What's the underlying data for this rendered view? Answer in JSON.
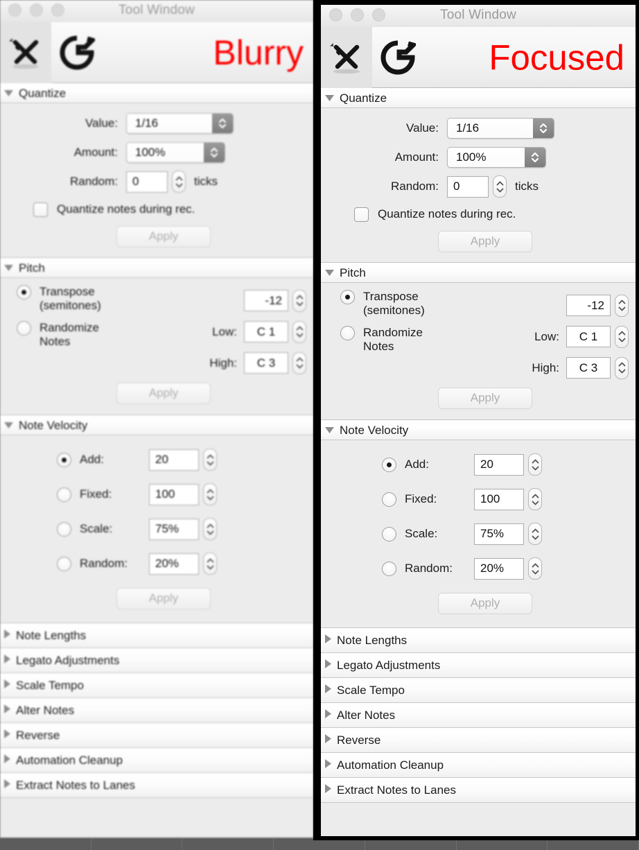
{
  "window": {
    "title": "Tool Window",
    "traffic_lights": [
      "close",
      "minimize",
      "zoom"
    ],
    "tabs": [
      {
        "name": "tools-tab",
        "icon": "wrench-screwdriver-icon",
        "selected": true
      },
      {
        "name": "groove-tab",
        "icon": "groove-g-icon",
        "selected": false
      }
    ]
  },
  "variants": {
    "left": {
      "badge": "Blurry",
      "badge_color": "#ff0000"
    },
    "right": {
      "badge": "Focused",
      "badge_color": "#ff0000"
    }
  },
  "sections": {
    "quantize": {
      "title": "Quantize",
      "expanded": true,
      "fields": {
        "value_label": "Value:",
        "value": "1/16",
        "amount_label": "Amount:",
        "amount": "100%",
        "random_label": "Random:",
        "random": "0",
        "random_units": "ticks",
        "checkbox_label": "Quantize notes during rec.",
        "checkbox_checked": false
      },
      "apply_label": "Apply"
    },
    "pitch": {
      "title": "Pitch",
      "expanded": true,
      "options": [
        {
          "label": "Transpose",
          "sublabel": "(semitones)",
          "selected": true
        },
        {
          "label": "Randomize",
          "sublabel": "Notes",
          "selected": false
        }
      ],
      "fields": {
        "transpose": "-12",
        "low_label": "Low:",
        "low": "C 1",
        "high_label": "High:",
        "high": "C 3"
      },
      "apply_label": "Apply"
    },
    "note_velocity": {
      "title": "Note Velocity",
      "expanded": true,
      "options": [
        {
          "label": "Add:",
          "value": "20",
          "selected": true
        },
        {
          "label": "Fixed:",
          "value": "100",
          "selected": false
        },
        {
          "label": "Scale:",
          "value": "75%",
          "selected": false
        },
        {
          "label": "Random:",
          "value": "20%",
          "selected": false
        }
      ],
      "apply_label": "Apply"
    }
  },
  "collapsed_sections": [
    {
      "title": "Note Lengths"
    },
    {
      "title": "Legato Adjustments"
    },
    {
      "title": "Scale Tempo"
    },
    {
      "title": "Alter Notes"
    },
    {
      "title": "Reverse"
    },
    {
      "title": "Automation Cleanup"
    },
    {
      "title": "Extract Notes to Lanes"
    }
  ],
  "colors": {
    "panel_bg": "#ececec",
    "header_bg": "#fcfcfc",
    "accent_red": "#ff0000",
    "border": "#c8c8c8",
    "desktop": "#5c5c5c"
  }
}
